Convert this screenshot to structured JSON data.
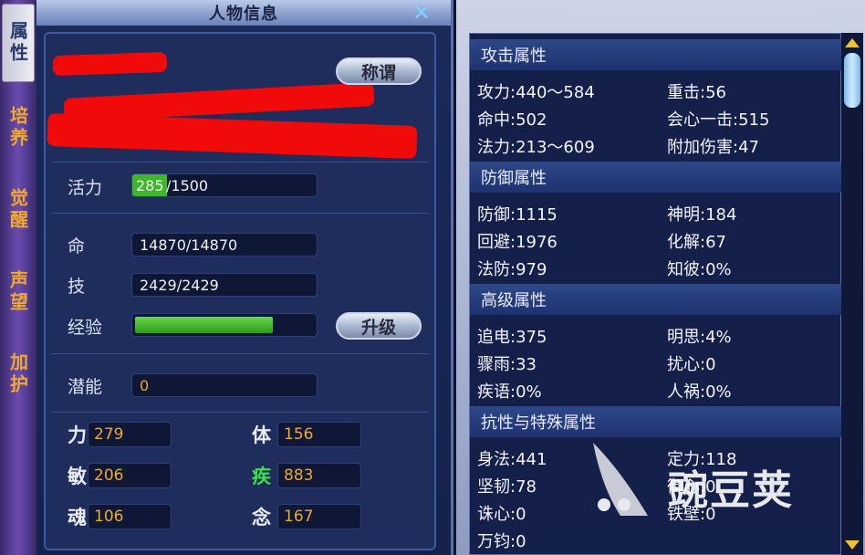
{
  "left_window": {
    "title": "人物信息",
    "side_tabs": [
      {
        "label": "属性",
        "active": true
      },
      {
        "label": "培养",
        "active": false
      },
      {
        "label": "觉醒",
        "active": false
      },
      {
        "label": "声望",
        "active": false
      },
      {
        "label": "加护",
        "active": false
      }
    ],
    "title_button": "称谓",
    "vitality": {
      "label": "活力",
      "current": "285",
      "max": "/1500",
      "fill_fraction": 0.19
    },
    "life": {
      "label": "命",
      "value": "14870/14870"
    },
    "skill": {
      "label": "技",
      "value": "2429/2429"
    },
    "experience": {
      "label": "经验",
      "fill_fraction": 0.77,
      "button": "升级"
    },
    "potential": {
      "label": "潜能",
      "value": "0"
    },
    "stats": [
      {
        "label": "力",
        "value": "279"
      },
      {
        "label": "体",
        "value": "156"
      },
      {
        "label": "敏",
        "value": "206"
      },
      {
        "label": "疾",
        "value": "883",
        "label_color": "#3ee04a"
      },
      {
        "label": "魂",
        "value": "106"
      },
      {
        "label": "念",
        "value": "167"
      }
    ]
  },
  "right_window": {
    "sections": [
      {
        "header": "攻击属性",
        "rows": [
          [
            "攻力:440～584",
            "重击:56"
          ],
          [
            "命中:502",
            "会心一击:515"
          ],
          [
            "法力:213～609",
            "附加伤害:47"
          ]
        ]
      },
      {
        "header": "防御属性",
        "rows": [
          [
            "防御:1115",
            "神明:184"
          ],
          [
            "回避:1976",
            "化解:67"
          ],
          [
            "法防:979",
            "知彼:0%"
          ]
        ]
      },
      {
        "header": "高级属性",
        "rows": [
          [
            "追电:375",
            "明思:4%"
          ],
          [
            "骤雨:33",
            "扰心:0"
          ],
          [
            "疾语:0%",
            "人祸:0%"
          ]
        ]
      },
      {
        "header": "抗性与特殊属性",
        "rows": [
          [
            "身法:441",
            "定力:118"
          ],
          [
            "坚韧:78",
            "御心:0"
          ],
          [
            "诛心:0",
            "铁壁:0"
          ],
          [
            "万钧:0",
            ""
          ]
        ]
      }
    ]
  },
  "watermark": {
    "text": "豌豆荚"
  },
  "colors": {
    "accent_orange": "#f0a830",
    "green_bar": "#3eb82a",
    "redaction": "#f00a0a"
  }
}
